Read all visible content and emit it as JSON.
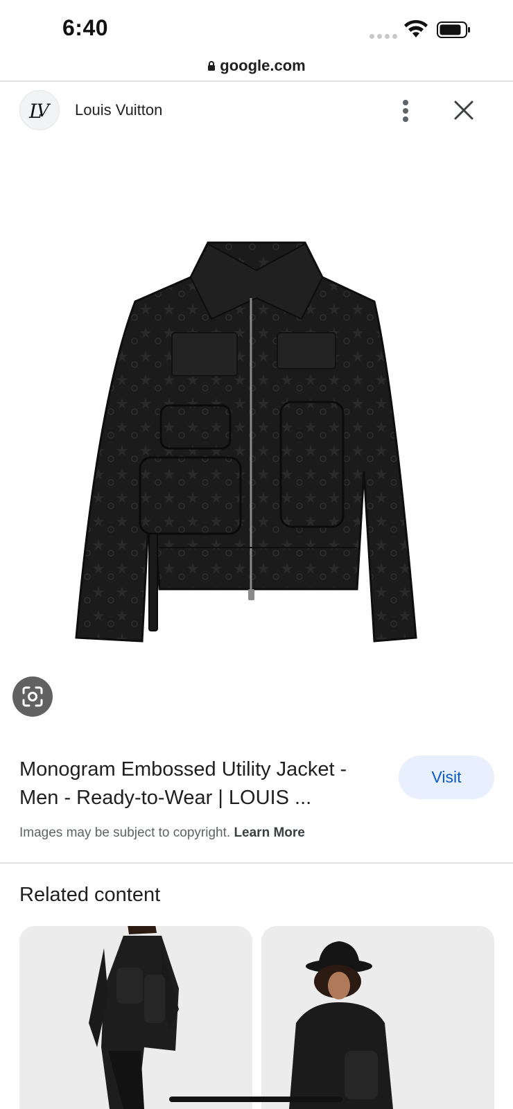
{
  "status_bar": {
    "time": "6:40",
    "icons": [
      "cellular-signal-icon",
      "wifi-icon",
      "battery-icon"
    ]
  },
  "browser": {
    "url": "google.com",
    "lock_icon": "lock-icon"
  },
  "image_viewer": {
    "source_name": "Louis Vuitton",
    "source_logo": "lv-monogram-logo",
    "more_icon": "vertical-dots-icon",
    "close_icon": "close-icon",
    "image_description_icon": "jacket-product-image",
    "lens_icon": "google-lens-icon",
    "title": "Monogram Embossed Utility Jacket - Men - Ready-to-Wear | LOUIS ...",
    "visit_label": "Visit",
    "copyright_text": "Images may be subject to copyright.",
    "learn_more_label": "Learn More"
  },
  "related": {
    "heading": "Related content",
    "cards": [
      {
        "icon": "related-image-model-front"
      },
      {
        "icon": "related-image-model-hat"
      }
    ]
  },
  "colors": {
    "accent": "#0b57d0",
    "visit_bg": "#e8f0fe",
    "text": "#202124",
    "muted": "#5f6368"
  }
}
